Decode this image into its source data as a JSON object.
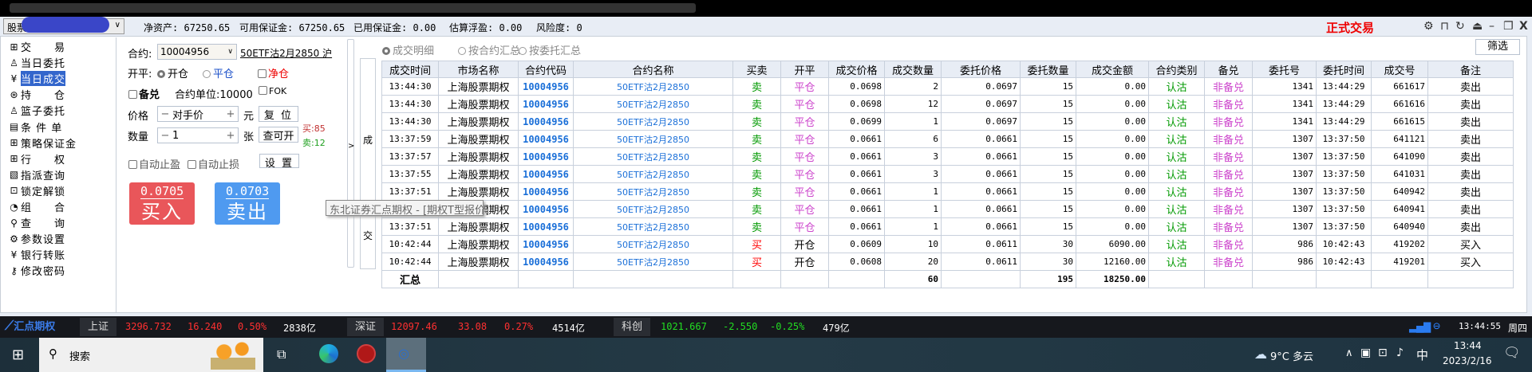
{
  "account": {
    "name": "股票期权账户",
    "chevron": "chevron-down-icon"
  },
  "stats": {
    "net_asset_label": "净资产:",
    "net_asset": "67250.65",
    "avail_label": "可用保证金:",
    "avail": "67250.65",
    "used_label": "已用保证金:",
    "used": "0.00",
    "float_label": "估算浮盈:",
    "float": "0.00",
    "risk_label": "风险度:",
    "risk": "0"
  },
  "mode": "正式交易",
  "window_icons": [
    "gear-icon",
    "lock-icon",
    "refresh-icon",
    "eject-icon",
    "minimize-icon",
    "restore-icon",
    "close-icon"
  ],
  "sidebar": {
    "items": [
      {
        "icon": "⊞",
        "label": "交　　易"
      },
      {
        "icon": "♙",
        "label": "当日委托"
      },
      {
        "icon": "¥",
        "label": "当日成交",
        "selected": true
      },
      {
        "icon": "⊛",
        "label": "持　　仓"
      },
      {
        "icon": "♙",
        "label": "篮子委托"
      },
      {
        "icon": "▤",
        "label": "条 件 单"
      },
      {
        "icon": "⊞",
        "label": "策略保证金"
      },
      {
        "icon": "⊞",
        "label": "行　　权"
      },
      {
        "icon": "▧",
        "label": "指派查询"
      },
      {
        "icon": "⊡",
        "label": "锁定解锁"
      },
      {
        "icon": "◔",
        "label": "组　　合"
      },
      {
        "icon": "⚲",
        "label": "查　　询"
      },
      {
        "icon": "⚙",
        "label": "参数设置"
      },
      {
        "icon": "¥",
        "label": "银行转账"
      },
      {
        "icon": "⚷",
        "label": "修改密码"
      }
    ]
  },
  "order": {
    "contract_label": "合约:",
    "contract_code": "10004956",
    "contract_name": "50ETF沽2月2850 沪",
    "kp_label": "开平:",
    "open": "开仓",
    "close": "平仓",
    "net": "净仓",
    "covered": "备兑",
    "unit": "合约单位:10000",
    "fok": "FOK",
    "price_label": "价格",
    "price_value": "对手价",
    "price_unit": "元",
    "reset": "复 位",
    "qty_label": "数量",
    "qty_value": "1",
    "qty_unit": "张",
    "query_open": "查可开",
    "buy_avail": "买:85",
    "sell_avail": "卖:12",
    "auto_tp": "自动止盈",
    "auto_sl": "自动止损",
    "settings": "设 置",
    "buy_price": "0.0705",
    "buy": "买入",
    "sell_price": "0.0703",
    "sell": "卖出",
    "collapse": ">"
  },
  "vtab": {
    "top": "成",
    "bottom": "交"
  },
  "views": [
    "成交明细",
    "按合约汇总",
    "按委托汇总"
  ],
  "filter": "筛选",
  "table": {
    "columns": [
      "成交时间",
      "市场名称",
      "合约代码",
      "合约名称",
      "买卖",
      "开平",
      "成交价格",
      "成交数量",
      "委托价格",
      "委托数量",
      "成交金额",
      "合约类别",
      "备兑",
      "委托号",
      "委托时间",
      "成交号",
      "备注"
    ],
    "rows": [
      [
        "13:44:30",
        "上海股票期权",
        "10004956",
        "50ETF沽2月2850",
        "卖",
        "平仓",
        "0.0698",
        "2",
        "0.0697",
        "15",
        "0.00",
        "认沽",
        "非备兑",
        "1341",
        "13:44:29",
        "661617",
        "卖出"
      ],
      [
        "13:44:30",
        "上海股票期权",
        "10004956",
        "50ETF沽2月2850",
        "卖",
        "平仓",
        "0.0698",
        "12",
        "0.0697",
        "15",
        "0.00",
        "认沽",
        "非备兑",
        "1341",
        "13:44:29",
        "661616",
        "卖出"
      ],
      [
        "13:44:30",
        "上海股票期权",
        "10004956",
        "50ETF沽2月2850",
        "卖",
        "平仓",
        "0.0699",
        "1",
        "0.0697",
        "15",
        "0.00",
        "认沽",
        "非备兑",
        "1341",
        "13:44:29",
        "661615",
        "卖出"
      ],
      [
        "13:37:59",
        "上海股票期权",
        "10004956",
        "50ETF沽2月2850",
        "卖",
        "平仓",
        "0.0661",
        "6",
        "0.0661",
        "15",
        "0.00",
        "认沽",
        "非备兑",
        "1307",
        "13:37:50",
        "641121",
        "卖出"
      ],
      [
        "13:37:57",
        "上海股票期权",
        "10004956",
        "50ETF沽2月2850",
        "卖",
        "平仓",
        "0.0661",
        "3",
        "0.0661",
        "15",
        "0.00",
        "认沽",
        "非备兑",
        "1307",
        "13:37:50",
        "641090",
        "卖出"
      ],
      [
        "13:37:55",
        "上海股票期权",
        "10004956",
        "50ETF沽2月2850",
        "卖",
        "平仓",
        "0.0661",
        "3",
        "0.0661",
        "15",
        "0.00",
        "认沽",
        "非备兑",
        "1307",
        "13:37:50",
        "641031",
        "卖出"
      ],
      [
        "13:37:51",
        "上海股票期权",
        "10004956",
        "50ETF沽2月2850",
        "卖",
        "平仓",
        "0.0661",
        "1",
        "0.0661",
        "15",
        "0.00",
        "认沽",
        "非备兑",
        "1307",
        "13:37:50",
        "640942",
        "卖出"
      ],
      [
        "13:37:51",
        "上海股票期权",
        "10004956",
        "50ETF沽2月2850",
        "卖",
        "平仓",
        "0.0661",
        "1",
        "0.0661",
        "15",
        "0.00",
        "认沽",
        "非备兑",
        "1307",
        "13:37:50",
        "640941",
        "卖出"
      ],
      [
        "13:37:51",
        "上海股票期权",
        "10004956",
        "50ETF沽2月2850",
        "卖",
        "平仓",
        "0.0661",
        "1",
        "0.0661",
        "15",
        "0.00",
        "认沽",
        "非备兑",
        "1307",
        "13:37:50",
        "640940",
        "卖出"
      ],
      [
        "10:42:44",
        "上海股票期权",
        "10004956",
        "50ETF沽2月2850",
        "买",
        "开仓",
        "0.0609",
        "10",
        "0.0611",
        "30",
        "6090.00",
        "认沽",
        "非备兑",
        "986",
        "10:42:43",
        "419202",
        "买入"
      ],
      [
        "10:42:44",
        "上海股票期权",
        "10004956",
        "50ETF沽2月2850",
        "买",
        "开仓",
        "0.0608",
        "20",
        "0.0611",
        "30",
        "12160.00",
        "认沽",
        "非备兑",
        "986",
        "10:42:43",
        "419201",
        "买入"
      ]
    ],
    "summary": {
      "label": "汇总",
      "qty": "60",
      "order_qty": "195",
      "amount": "18250.00"
    }
  },
  "tooltip": "东北证券汇点期权 - [期权T型报价]",
  "ticker": {
    "logo": "汇点期权",
    "sh": {
      "name": "上证",
      "price": "3296.732",
      "chg": "16.240",
      "pct": "0.50%",
      "vol": "2838亿"
    },
    "sz": {
      "name": "深证",
      "price": "12097.46",
      "chg": "33.08",
      "pct": "0.27%",
      "vol": "4514亿"
    },
    "kc": {
      "name": "科创",
      "price": "1021.667",
      "chg": "-2.550",
      "pct": "-0.25%",
      "vol": "479亿"
    },
    "time": "13:44:55",
    "weekday": "周四"
  },
  "taskbar": {
    "search": "搜索",
    "weather": "9°C 多云",
    "ime": "中",
    "time": "13:44",
    "date": "2023/2/16"
  },
  "colors": {
    "up": "#ff3030",
    "down": "#22dd22",
    "sell_text": "#009900",
    "buy_text": "#ff0000",
    "close_pos": "#cc44cc",
    "code_blue": "#1a6fd8",
    "buy_btn": "#e9565a",
    "sell_btn": "#4f9af0"
  }
}
